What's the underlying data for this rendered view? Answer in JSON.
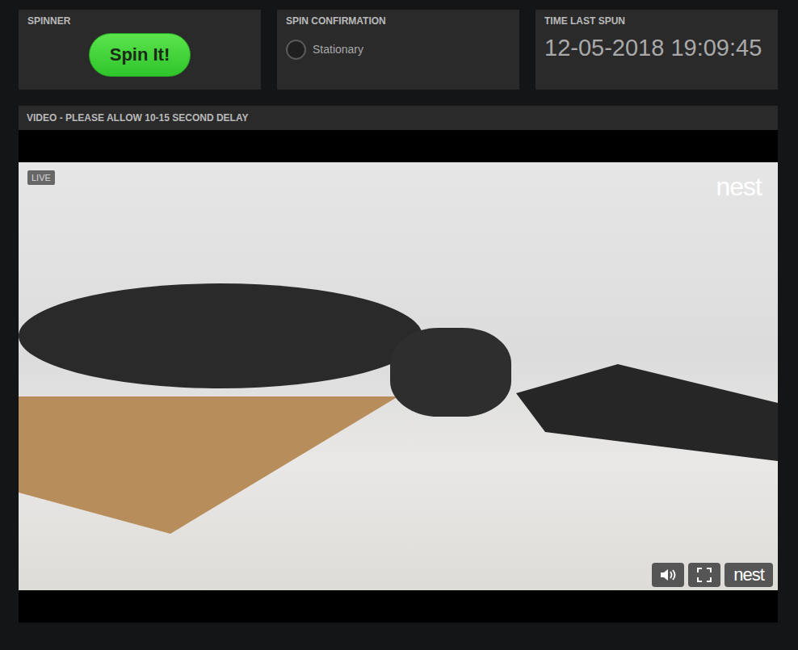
{
  "spinner": {
    "label": "SPINNER",
    "button": "Spin It!"
  },
  "confirmation": {
    "label": "SPIN CONFIRMATION",
    "status": "Stationary",
    "spinning": false
  },
  "last_spun": {
    "label": "TIME LAST SPUN",
    "time": "12-05-2018 19:09:45"
  },
  "video": {
    "title": "VIDEO - PLEASE ALLOW 10-15 SECOND DELAY",
    "live_badge": "LIVE",
    "watermark": "nest",
    "brand_button": "nest"
  }
}
